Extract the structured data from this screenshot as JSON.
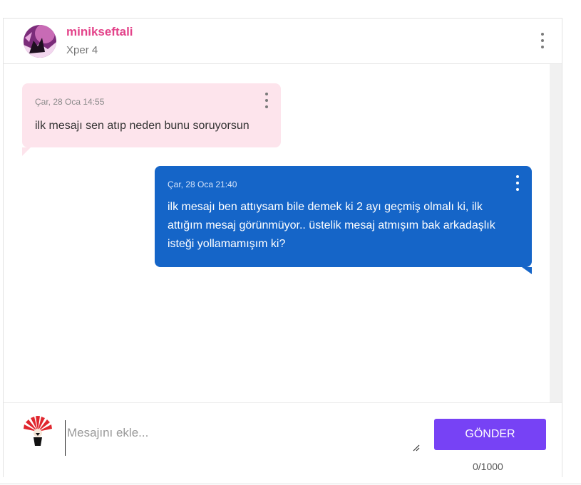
{
  "header": {
    "username": "minikseftali",
    "level": "Xper 4",
    "avatar_icon": "user-avatar-icon"
  },
  "messages": [
    {
      "direction": "incoming",
      "time": "Çar, 28 Oca 14:55",
      "text": "ilk mesajı sen atıp neden bunu soruyorsun",
      "bg_color": "#fde4ec"
    },
    {
      "direction": "outgoing",
      "time": "Çar, 28 Oca 21:40",
      "text": "ilk mesajı ben attıysam bile demek ki 2 ayı geçmiş olmalı ki, ilk attığım mesaj görünmüyor.. üstelik mesaj atmışım bak arkadaşlık isteği yollamamışım ki?",
      "bg_color": "#1565c8"
    }
  ],
  "composer": {
    "placeholder": "Mesajını ekle...",
    "value": "",
    "send_label": "GÖNDER",
    "char_count": "0/1000",
    "send_color": "#7742f5"
  },
  "colors": {
    "username": "#e3438a",
    "accent": "#7742f5"
  }
}
